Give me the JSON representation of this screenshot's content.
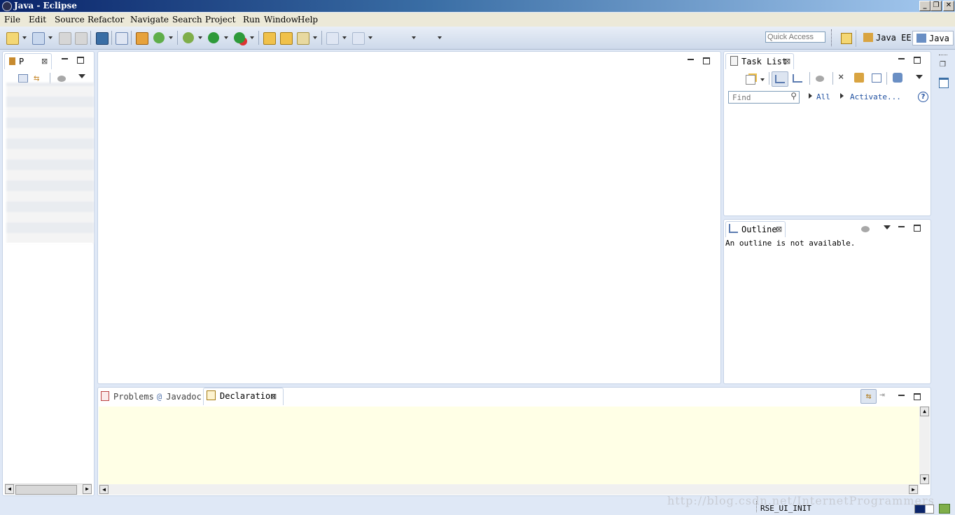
{
  "window": {
    "title": "Java - Eclipse",
    "controls": [
      "minimize",
      "restore",
      "close"
    ]
  },
  "menubar": {
    "items": [
      "File",
      "Edit",
      "Source",
      "Refactor",
      "Navigate",
      "Search",
      "Project",
      "Run",
      "Window",
      "Help"
    ]
  },
  "toolbar": {
    "quick_access_placeholder": "Quick Access",
    "perspectives": [
      "Java EE",
      "Java"
    ]
  },
  "package_explorer": {
    "tab_label": "P"
  },
  "task_list": {
    "tab_label": "Task List",
    "find_placeholder": "Find",
    "all_label": "All",
    "activate_label": "Activate...",
    "help_symbol": "?"
  },
  "outline": {
    "tab_label": "Outline",
    "message": "An outline is not available."
  },
  "bottom_panel": {
    "tabs": [
      "Problems",
      "Javadoc",
      "Declaration"
    ],
    "tab_prefixes": [
      "",
      "@",
      ""
    ],
    "active_tab": "Declaration"
  },
  "status": {
    "text": "RSE_UI_INIT"
  },
  "watermark": {
    "text": "http://blog.csdn.net/InternetProgrammers"
  },
  "colors": {
    "title_gradient_start": "#0a246a",
    "declaration_bg": "#ffffe6",
    "workbench_bg": "#dfe8f6",
    "panel_border": "#c6d3e6"
  }
}
